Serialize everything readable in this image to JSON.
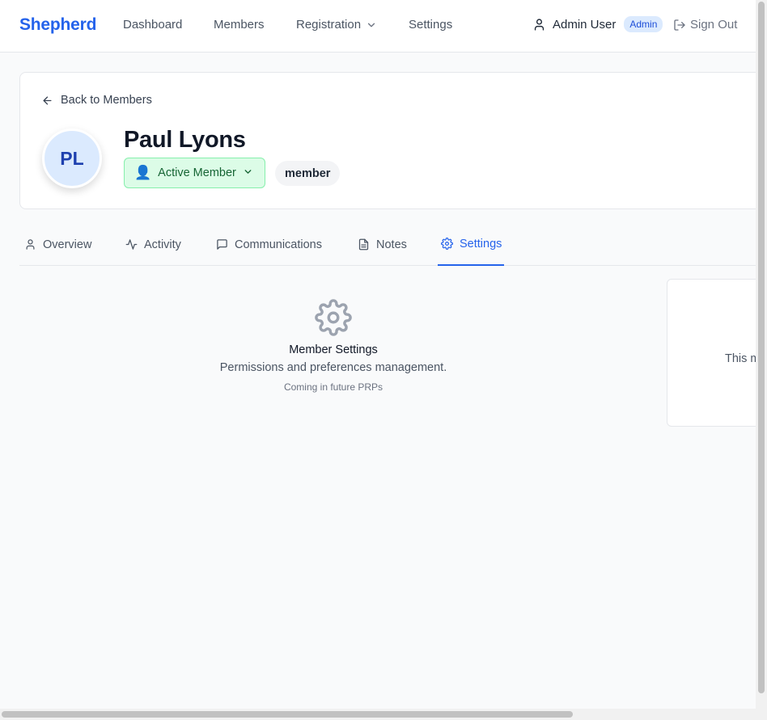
{
  "nav": {
    "brand": "Shepherd",
    "links": {
      "dashboard": "Dashboard",
      "members": "Members",
      "registration": "Registration",
      "settings": "Settings"
    },
    "user_name": "Admin User",
    "user_role": "Admin",
    "sign_out": "Sign Out"
  },
  "profile": {
    "back_label": "Back to Members",
    "initials": "PL",
    "name": "Paul Lyons",
    "status_icon": "👤",
    "status": "Active Member",
    "role": "member"
  },
  "tabs": {
    "overview": "Overview",
    "activity": "Activity",
    "communications": "Communications",
    "notes": "Notes",
    "settings": "Settings",
    "active": "settings"
  },
  "settings_panel": {
    "title": "Member Settings",
    "description": "Permissions and preferences management.",
    "note": "Coming in future PRPs"
  },
  "side_card": {
    "text_fragment": "This m"
  },
  "colors": {
    "brand": "#2563eb",
    "active_status_bg": "#dcfce7",
    "active_status_text": "#166534",
    "admin_badge_bg": "#dbeafe"
  }
}
